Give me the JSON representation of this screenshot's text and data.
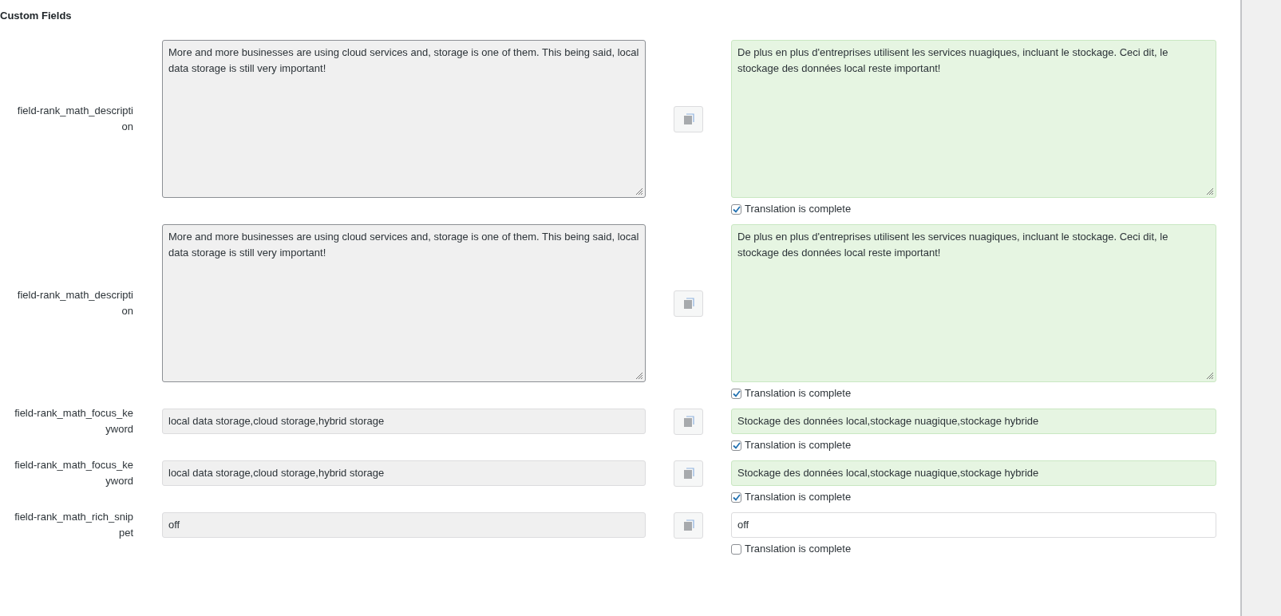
{
  "section_title": "Custom Fields",
  "fields": [
    {
      "label": "field-rank_math_description",
      "kind": "textarea",
      "source": "More and more businesses are using cloud services and, storage is one of them. This being said, local data storage is still very important!",
      "target": "De plus en plus d'entreprises utilisent les services nuagiques, incluant le stockage. Ceci dit, le stockage des données local reste important!",
      "complete_label": "Translation is complete",
      "checked": true
    },
    {
      "label": "field-rank_math_description",
      "kind": "textarea",
      "source": "More and more businesses are using cloud services and, storage is one of them. This being said, local data storage is still very important!",
      "target": "De plus en plus d'entreprises utilisent les services nuagiques, incluant le stockage. Ceci dit, le stockage des données local reste important!",
      "complete_label": "Translation is complete",
      "checked": true
    },
    {
      "label": "field-rank_math_focus_keyword",
      "kind": "input",
      "source": "local data storage,cloud storage,hybrid storage",
      "target": "Stockage des données local,stockage nuagique,stockage hybride",
      "complete_label": "Translation is complete",
      "checked": true
    },
    {
      "label": "field-rank_math_focus_keyword",
      "kind": "input",
      "source": "local data storage,cloud storage,hybrid storage",
      "target": "Stockage des données local,stockage nuagique,stockage hybride",
      "complete_label": "Translation is complete",
      "checked": true
    },
    {
      "label": "field-rank_math_rich_snippet",
      "kind": "input",
      "source": "off",
      "target": "off",
      "complete_label": "Translation is complete",
      "checked": false
    }
  ]
}
